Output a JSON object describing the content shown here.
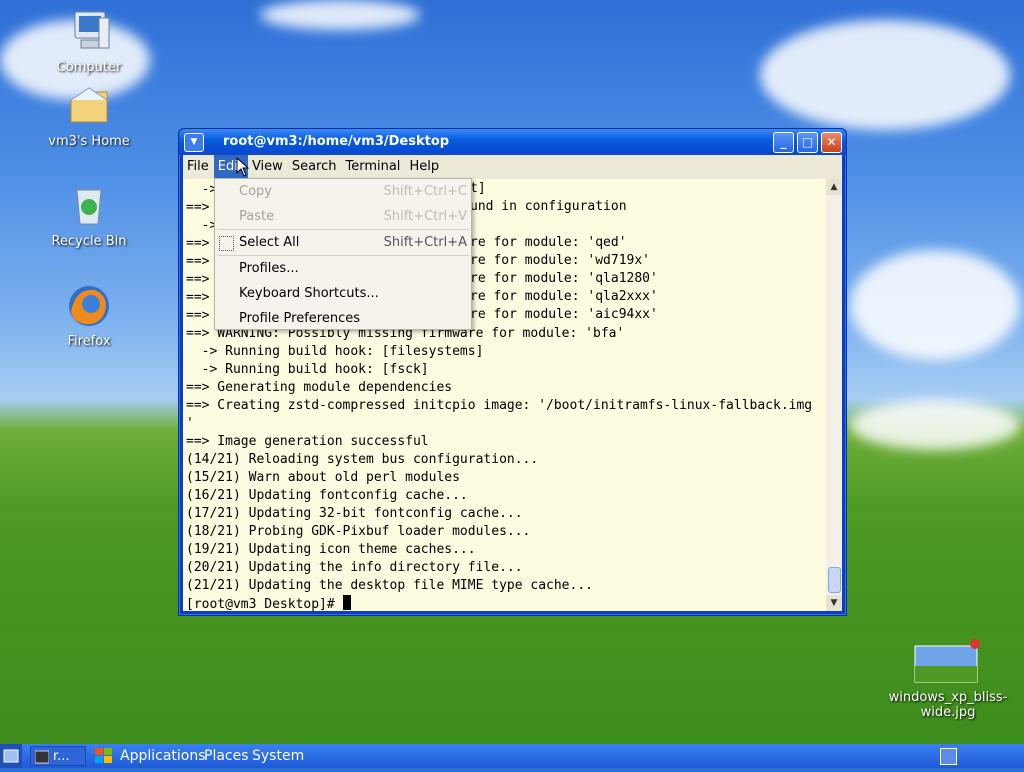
{
  "desktop": {
    "icons": [
      {
        "label": "Computer",
        "icon": "computer-icon"
      },
      {
        "label": "vm3's Home",
        "icon": "home-folder-icon"
      },
      {
        "label": "Recycle Bin",
        "icon": "recycle-bin-icon"
      },
      {
        "label": "Firefox",
        "icon": "firefox-icon"
      },
      {
        "label": "windows_xp_bliss-wide.jpg",
        "icon": "image-file-icon"
      }
    ]
  },
  "window": {
    "title": "root@vm3:/home/vm3/Desktop",
    "menu": [
      "File",
      "Edit",
      "View",
      "Search",
      "Terminal",
      "Help"
    ],
    "active_menu": "Edit"
  },
  "edit_menu": {
    "items": [
      {
        "label": "Copy",
        "shortcut": "Shift+Ctrl+C",
        "enabled": false
      },
      {
        "label": "Paste",
        "shortcut": "Shift+Ctrl+V",
        "enabled": false
      },
      {
        "label": "Select All",
        "shortcut": "Shift+Ctrl+A",
        "enabled": true
      },
      {
        "label": "Profiles...",
        "shortcut": "",
        "enabled": true
      },
      {
        "label": "Keyboard Shortcuts...",
        "shortcut": "",
        "enabled": true
      },
      {
        "label": "Profile Preferences",
        "shortcut": "",
        "enabled": true
      }
    ]
  },
  "terminal": {
    "lines": [
      "  -> ",
      "==> ",
      "  -> ",
      "==> ",
      "==> ",
      "==> ",
      "==> ",
      "==> ",
      "==> WARNING: Possibly missing firmware for module: 'bfa'",
      "  -> Running build hook: [filesystems]",
      "  -> Running build hook: [fsck]",
      "==> Generating module dependencies",
      "==> Creating zstd-compressed initcpio image: '/boot/initramfs-linux-fallback.img",
      "'",
      "==> Image generation successful",
      "(14/21) Reloading system bus configuration...",
      "(15/21) Warn about old perl modules",
      "(16/21) Updating fontconfig cache...",
      "(17/21) Updating 32-bit fontconfig cache...",
      "(18/21) Probing GDK-Pixbuf loader modules...",
      "(19/21) Updating icon theme caches...",
      "(20/21) Updating the info directory file...",
      "(21/21) Updating the desktop file MIME type cache..."
    ],
    "partial_right": [
      "t]",
      "und in configuration",
      "",
      "re for module: 'qed'",
      "re for module: 'wd719x'",
      "re for module: 'qla1280'",
      "re for module: 'qla2xxx'",
      "re for module: 'aic94xx'"
    ],
    "prompt": "[root@vm3 Desktop]# "
  },
  "taskbar": {
    "task_label": "r...",
    "applications": "Applications",
    "places": "Places",
    "system": "System"
  }
}
